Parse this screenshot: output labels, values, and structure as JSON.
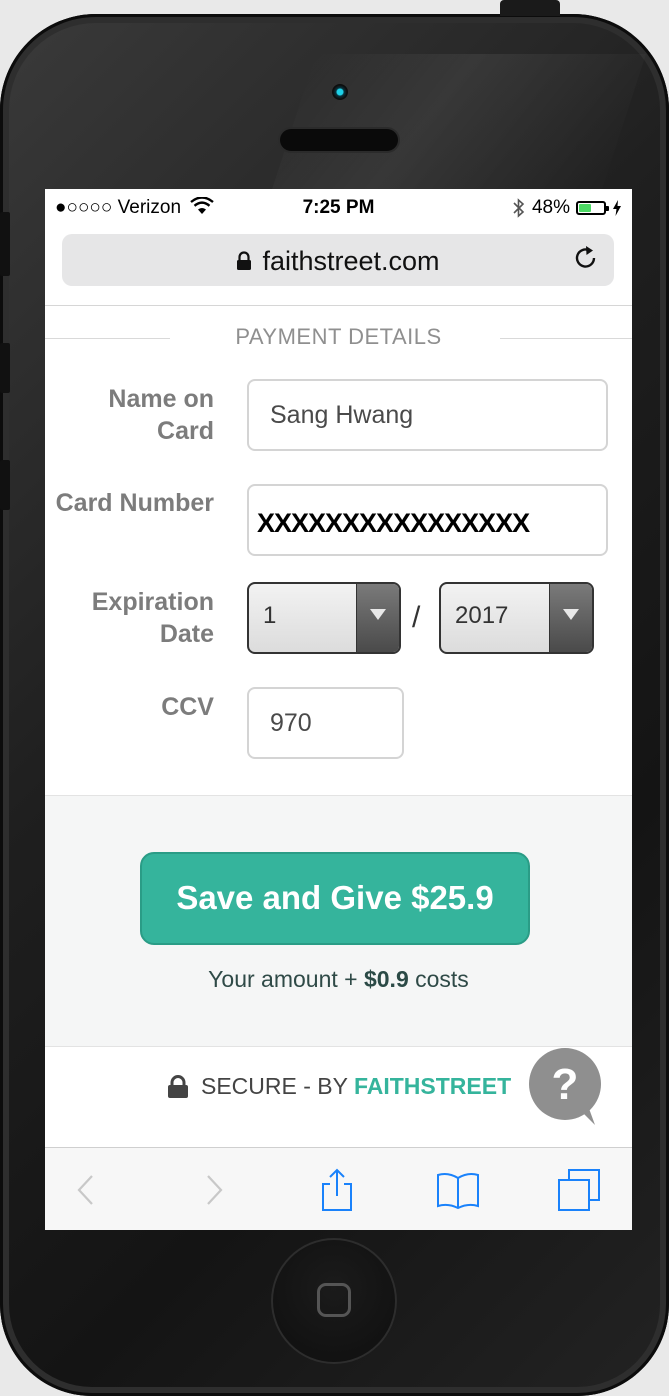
{
  "status_bar": {
    "carrier": "●○○○○ Verizon",
    "time": "7:25 PM",
    "battery_text": "48%",
    "battery_level": 0.48,
    "icons": [
      "wifi-icon",
      "bluetooth-icon",
      "battery-icon",
      "charging-bolt-icon"
    ]
  },
  "browser": {
    "url": "faithstreet.com",
    "icons": [
      "lock-icon",
      "reload-icon"
    ]
  },
  "form": {
    "section_title": "PAYMENT DETAILS",
    "name_label_line1": "Name on",
    "name_label_line2": "Card",
    "name_value": "Sang Hwang",
    "card_label": "Card Number",
    "card_value": "XXXXXXXXXXXXXXXX",
    "expiration_label_line1": "Expiration",
    "expiration_label_line2": "Date",
    "exp_month": "1",
    "exp_separator": "/",
    "exp_year": "2017",
    "ccv_label": "CCV",
    "ccv_value": "970"
  },
  "give": {
    "button_label": "Save and Give $25.9",
    "costs_prefix": "Your amount + ",
    "costs_amount": "$0.9",
    "costs_suffix": " costs"
  },
  "footer": {
    "secure_prefix": "SECURE - BY ",
    "secure_brand": "FAITHSTREET",
    "help_glyph": "?"
  },
  "toolbar": {
    "icons": [
      "back-icon",
      "forward-icon",
      "share-icon",
      "bookmarks-icon",
      "tabs-icon"
    ]
  },
  "colors": {
    "accent": "#35b49c",
    "label": "#7c7c7c",
    "help_bubble": "#8f8f8f",
    "ios_blue": "#1a82fb"
  }
}
